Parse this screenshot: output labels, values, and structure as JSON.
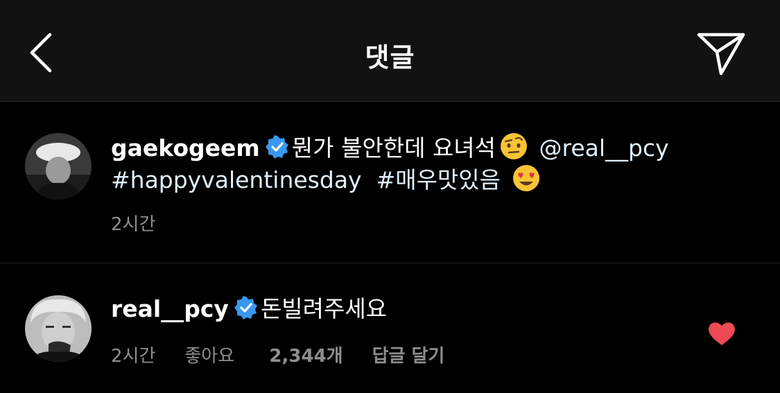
{
  "header": {
    "title": "댓글"
  },
  "caption": {
    "username": "gaekogeem",
    "text": "뭔가 불안한데 요녀석",
    "mention": "@real__pcy",
    "hashtag1": "#happyvalentinesday",
    "hashtag2": "#매우맛있음",
    "time": "2시간",
    "emoji1": "raised-eyebrow-emoji",
    "emoji2": "heart-eyes-emoji"
  },
  "comment": {
    "username": "real__pcy",
    "text": "돈빌려주세요",
    "time": "2시간",
    "likes_label": "좋아요",
    "likes_count": "2,344개",
    "reply_label": "답글 달기",
    "liked": true
  },
  "colors": {
    "header_bg": "#121212",
    "body_bg": "#000000",
    "link": "#e0f1ff",
    "meta": "#8e8e8e",
    "verified": "#3897f0",
    "like": "#ed4956"
  }
}
